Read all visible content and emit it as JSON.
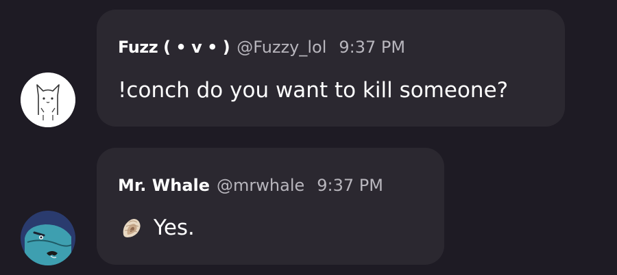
{
  "messages": [
    {
      "display_name": "Fuzz ( • v • )",
      "handle": "@Fuzzy_lol",
      "time": "9:37 PM",
      "text": "!conch do you want to kill someone?",
      "avatar_icon": "cat-avatar-icon"
    },
    {
      "display_name": "Mr. Whale",
      "handle": "@mrwhale",
      "time": "9:37 PM",
      "text": "Yes.",
      "avatar_icon": "whale-avatar-icon",
      "prefix_icon": "shell-icon"
    }
  ],
  "colors": {
    "background": "#1e1b24",
    "bubble": "#2b2830",
    "primary_text": "#ffffff",
    "secondary_text": "#b8b6bd"
  }
}
